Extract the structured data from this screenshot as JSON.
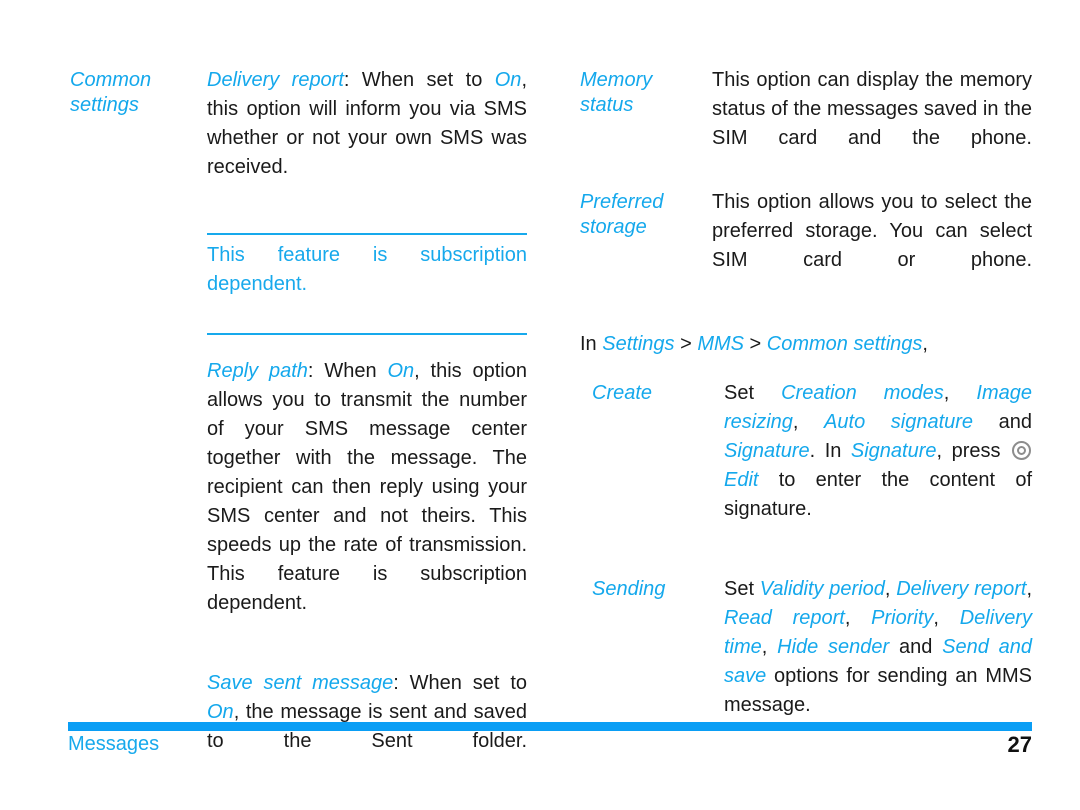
{
  "document": {
    "title": "Messages",
    "page_number": "27",
    "accent_blue": "#14a8ec",
    "footer_bar_color": "#0a9ef5"
  },
  "left_column": {
    "label": {
      "line1": "Common",
      "line2": "settings"
    },
    "delivery_report": {
      "term": "Delivery report",
      "colon": ": When set to ",
      "value": "On",
      "rest": ", this option will inform you via SMS whether or not your own SMS was received."
    },
    "note": "This feature is subscription dependent.",
    "reply_path": {
      "term": "Reply path",
      "colon": ": When ",
      "value": "On",
      "rest": ", this option allows you to transmit the number of your SMS message center together with the message. The recipient can then reply using your SMS center and not theirs. This speeds up the rate of transmission. This feature is subscription dependent."
    },
    "save_sent_message": {
      "term": "Save sent message",
      "colon": ": When set to ",
      "value": "On",
      "rest": ", the message is sent and saved to the Sent folder."
    }
  },
  "right_column": {
    "memory_status": {
      "label_line1": "Memory",
      "label_line2": "status",
      "body": "This option can display the memory status of the messages saved in the SIM card and the phone."
    },
    "preferred_storage": {
      "label_line1": "Preferred",
      "label_line2": "storage",
      "body": "This option allows you to select the preferred storage. You can select SIM card or phone."
    },
    "breadcrumb": {
      "prefix": "In ",
      "item1": "Settings",
      "sep1": " > ",
      "item2": "MMS",
      "sep2": " > ",
      "item3": "Common settings",
      "suffix": ","
    },
    "create": {
      "label": "Create",
      "set": "Set ",
      "opt1": "Creation modes",
      "c1": ", ",
      "opt2": "Image resizing",
      "c2": ", ",
      "opt3": "Auto signature",
      "and": " and ",
      "opt4": "Signature",
      "mid": ". In ",
      "opt5": "Signature",
      "press": ", press ",
      "edit": "Edit",
      "tail": " to enter the content of signature.",
      "nav_icon": "nav-key-icon"
    },
    "sending": {
      "label": "Sending",
      "set": "Set ",
      "opt1": "Validity period",
      "c1": ", ",
      "opt2": "Delivery report",
      "c2": ", ",
      "opt3": "Read report",
      "c3": ", ",
      "opt4": "Priority",
      "c4": ", ",
      "opt5": "Delivery time",
      "c5": ", ",
      "opt6": "Hide sender",
      "and": " and ",
      "opt7": "Send and save",
      "tail": " options for sending an MMS message."
    }
  }
}
